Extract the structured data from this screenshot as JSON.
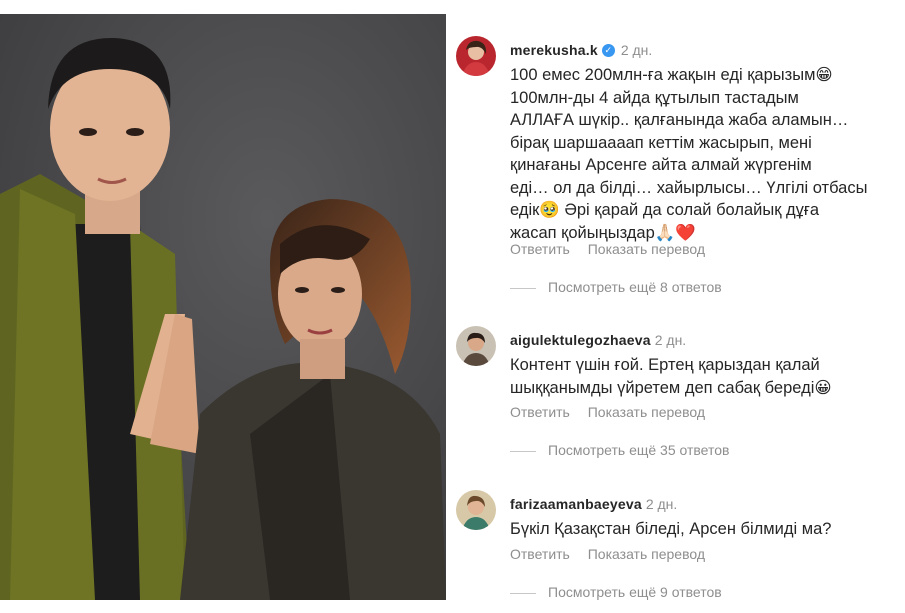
{
  "photo": {
    "alt": "couple-portrait"
  },
  "comments": [
    {
      "username": "merekusha.k",
      "verified": true,
      "time": "2 дн.",
      "lines": [
        "100 емес 200млн-ға жақын еді қарызым😁",
        "100млн-ды 4 айда құтылып тастадым",
        "АЛЛАҒА шүкір.. қалғанында жаба аламын…",
        "бірақ шаршаааап кеттім жасырып, мені",
        "қинағаны Арсенге айта алмай жүргенім",
        "еді… ол да білді… хайырлысы… Үлгілі отбасы",
        "едік🥹  Әрі қарай да солай болайық дұға",
        "жасап қойыңыздар🙏🏻❤️"
      ],
      "reply": "Ответить",
      "translate": "Показать перевод",
      "more_replies": "Посмотреть ещё 8 ответов"
    },
    {
      "username": "aigulektulegozhaeva",
      "verified": false,
      "time": "2 дн.",
      "lines": [
        "Контент үшін ғой. Ертең қарыздан қалай",
        "шыққанымды үйретем деп сабақ береді😀"
      ],
      "reply": "Ответить",
      "translate": "Показать перевод",
      "more_replies": "Посмотреть ещё 35 ответов"
    },
    {
      "username": "farizaamanbaeyeva",
      "verified": false,
      "time": "2 дн.",
      "lines": [
        "Бүкіл Қазақстан біледі, Арсен білмиді ма?"
      ],
      "reply": "Ответить",
      "translate": "Показать перевод",
      "more_replies": "Посмотреть ещё 9 ответов"
    }
  ],
  "colors": {
    "verified": "#3897f0",
    "muted": "#8e8e8e",
    "text": "#262626",
    "photo_bg": "#4b4b4d",
    "kimono": "#6b6f22"
  }
}
